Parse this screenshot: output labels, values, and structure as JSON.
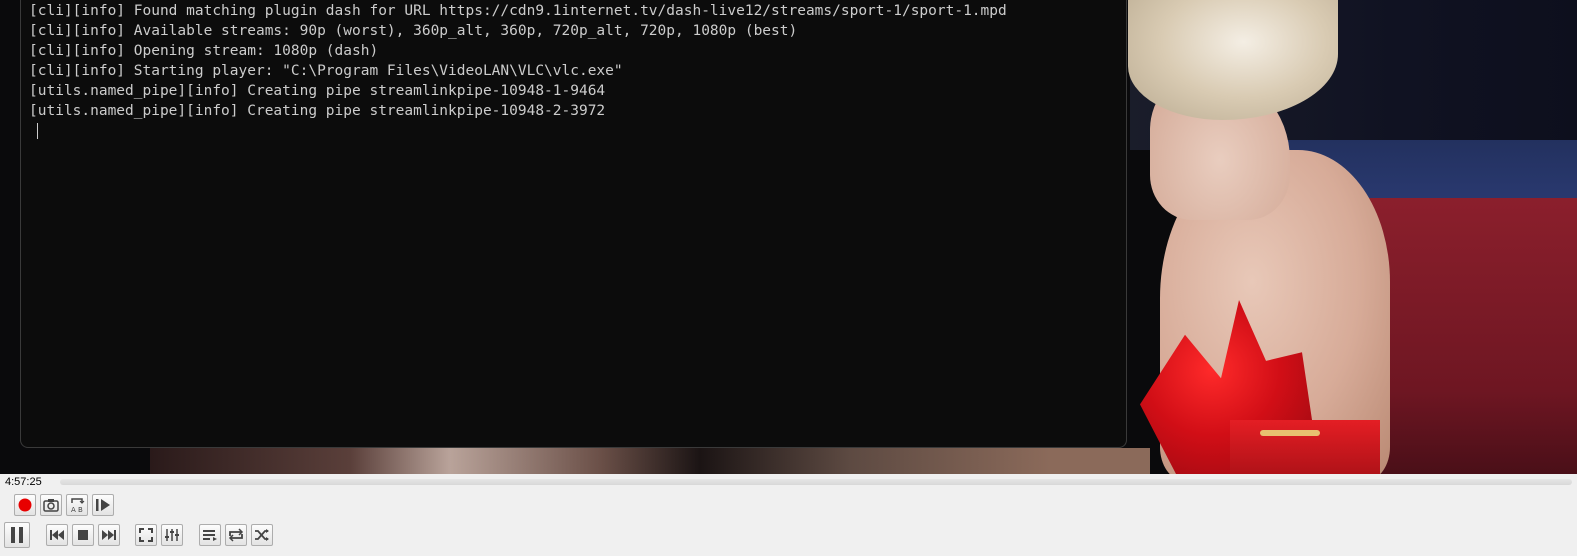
{
  "terminal": {
    "lines": [
      "[cli][info] Found matching plugin dash for URL https://cdn9.1internet.tv/dash-live12/streams/sport-1/sport-1.mpd",
      "[cli][info] Available streams: 90p (worst), 360p_alt, 360p, 720p_alt, 720p, 1080p (best)",
      "[cli][info] Opening stream: 1080p (dash)",
      "[cli][info] Starting player: \"C:\\Program Files\\VideoLAN\\VLC\\vlc.exe\"",
      "[utils.named_pipe][info] Creating pipe streamlinkpipe-10948-1-9464",
      "[utils.named_pipe][info] Creating pipe streamlinkpipe-10948-2-3972"
    ]
  },
  "player": {
    "elapsed_time": "4:57:25",
    "progress": 0,
    "accent_color": "#e80000",
    "icons": {
      "record": "record-icon",
      "snapshot": "camera-icon",
      "loop_ab": "loop-ab-icon",
      "frame_step": "frame-step-icon",
      "pause": "pause-icon",
      "previous": "previous-icon",
      "stop": "stop-icon",
      "next": "next-icon",
      "fullscreen": "fullscreen-icon",
      "extended_settings": "equalizer-icon",
      "playlist": "playlist-icon",
      "loop": "loop-icon",
      "shuffle": "shuffle-icon"
    }
  }
}
